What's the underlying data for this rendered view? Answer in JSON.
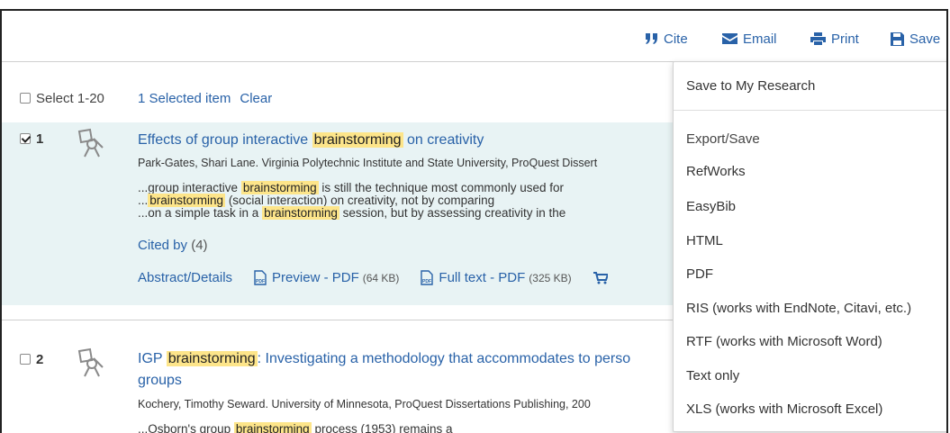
{
  "toolbar": {
    "cite": "Cite",
    "email": "Email",
    "print": "Print",
    "save": "Save"
  },
  "selection": {
    "select_all": "Select 1-20",
    "selected": "1 Selected item",
    "clear": "Clear"
  },
  "results": [
    {
      "number": "1",
      "checked": true,
      "title_pre": "Effects of group interactive ",
      "title_hl": "brainstorming",
      "title_post": " on creativity",
      "meta": "Park-Gates, Shari Lane. Virginia Polytechnic Institute and State University, ProQuest Dissert",
      "snippet1_pre": "...group interactive ",
      "snippet1_hl": "brainstorming",
      "snippet1_post": " is still the technique most commonly used for",
      "snippet2_pre": "...",
      "snippet2_hl": "brainstorming",
      "snippet2_post": " (social interaction) on creativity, not by comparing",
      "snippet3_pre": "...on a simple task in a ",
      "snippet3_hl": "brainstorming",
      "snippet3_post": " session, but by assessing creativity in the",
      "cited_label": "Cited by",
      "cited_count": "(4)",
      "abstract": "Abstract/Details",
      "preview": "Preview - PDF",
      "preview_size": "(64 KB)",
      "fulltext": "Full text - PDF",
      "fulltext_size": "(325 KB)"
    },
    {
      "number": "2",
      "checked": false,
      "title_pre": "IGP ",
      "title_hl": "brainstorming",
      "title_post": ": Investigating a methodology that accommodates to perso",
      "title_line2": "groups",
      "meta": "Kochery, Timothy Seward. University of Minnesota, ProQuest Dissertations Publishing, 200",
      "snippet1_pre": "...Osborn's group ",
      "snippet1_hl": "brainstorming",
      "snippet1_post": " process (1953) remains a"
    }
  ],
  "dropdown": {
    "save_to_research": "Save to My Research",
    "export_header": "Export/Save",
    "items": [
      "RefWorks",
      "EasyBib",
      "HTML",
      "PDF",
      "RIS (works with EndNote, Citavi, etc.)",
      "RTF (works with Microsoft Word)",
      "Text only",
      "XLS (works with Microsoft Excel)"
    ]
  },
  "colors": {
    "link": "#2962a8",
    "highlight": "#fde58a",
    "selected_row": "#e8f3f4"
  }
}
